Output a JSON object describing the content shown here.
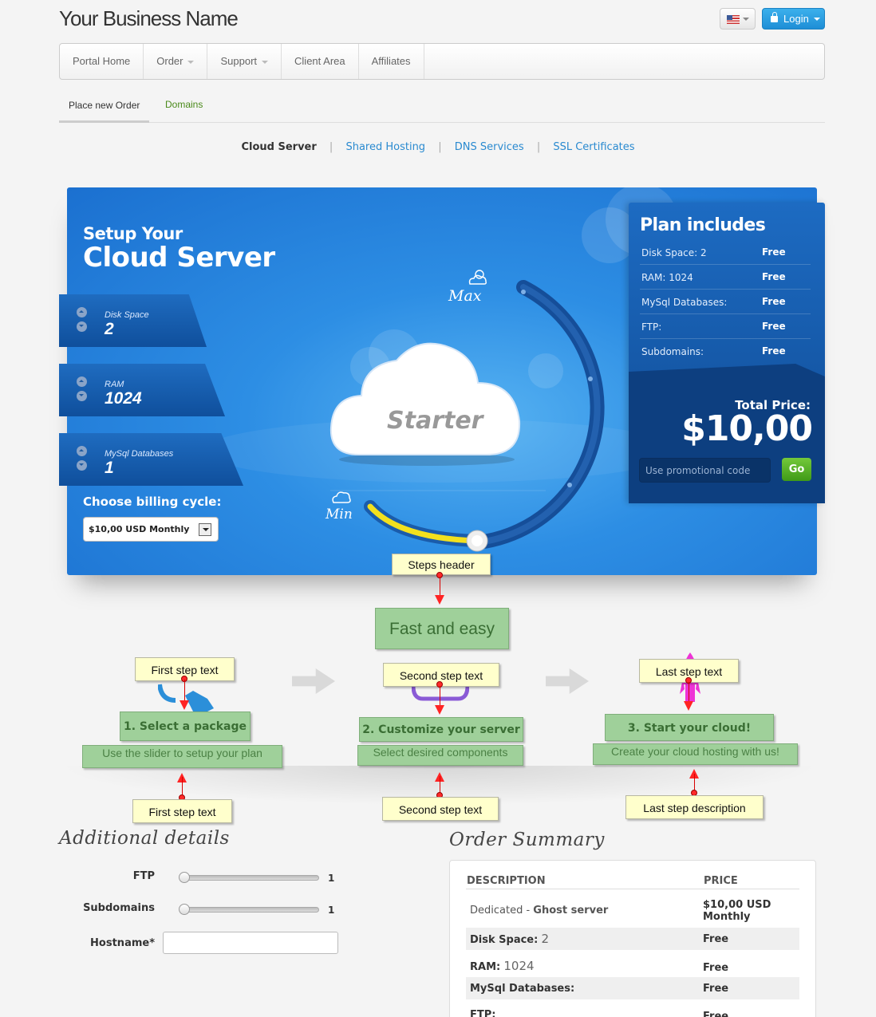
{
  "header": {
    "brand": "Your Business Name",
    "login_label": "Login",
    "flag_icon": "us-flag-icon"
  },
  "nav": [
    {
      "label": "Portal Home",
      "dropdown": false
    },
    {
      "label": "Order",
      "dropdown": true
    },
    {
      "label": "Support",
      "dropdown": true
    },
    {
      "label": "Client Area",
      "dropdown": false
    },
    {
      "label": "Affiliates",
      "dropdown": false
    }
  ],
  "subtabs": {
    "active": "Place new Order",
    "other": "Domains"
  },
  "categories": {
    "active": "Cloud Server",
    "links": [
      "Shared Hosting",
      "DNS Services",
      "SSL Certificates"
    ],
    "separator": "|"
  },
  "hero": {
    "title_line1": "Setup Your",
    "title_line2": "Cloud Server",
    "options": [
      {
        "label": "Disk Space",
        "value": "2"
      },
      {
        "label": "RAM",
        "value": "1024"
      },
      {
        "label": "MySql Databases",
        "value": "1"
      }
    ],
    "billing_label": "Choose billing cycle:",
    "billing_value": "$10,00 USD Monthly",
    "plan_name": "Starter",
    "max_label": "Max",
    "min_label": "Min",
    "slider_level": 0.08
  },
  "plan": {
    "title": "Plan includes",
    "rows": [
      {
        "k": "Disk Space: 2",
        "v": "Free"
      },
      {
        "k": "RAM: 1024",
        "v": "Free"
      },
      {
        "k": "MySql Databases:",
        "v": "Free"
      },
      {
        "k": "FTP:",
        "v": "Free"
      },
      {
        "k": "Subdomains:",
        "v": "Free"
      }
    ],
    "total_label": "Total Price:",
    "total_value": "$10,00",
    "promo_placeholder": "Use promotional code",
    "go_label": "Go"
  },
  "annotations": {
    "steps_header_note": "Steps header",
    "steps_header": "Fast and easy",
    "notes_top": [
      "First step text",
      "Second step text",
      "Last step text"
    ],
    "steps": [
      "1. Select a package",
      "2. Customize your server",
      "3. Start your cloud!"
    ],
    "descs": [
      "Use the slider to setup your plan",
      "Select desired components",
      "Create your cloud hosting with us!"
    ],
    "notes_bottom": [
      "First step text",
      "Second step text",
      "Last step description"
    ]
  },
  "details": {
    "title": "Additional details",
    "ftp_label": "FTP",
    "ftp_value": "1",
    "sub_label": "Subdomains",
    "sub_value": "1",
    "host_label": "Hostname*"
  },
  "summary": {
    "title": "Order Summary",
    "col_desc": "DESCRIPTION",
    "col_price": "PRICE",
    "row1_prefix": "Dedicated - ",
    "row1_name": "Ghost server",
    "row1_price_a": "$10,00 USD",
    "row1_price_b": "Monthly",
    "row2_label": "Disk Space:",
    "row2_val": "2",
    "row2_price": "Free",
    "row3_label": "RAM:",
    "row3_val": "1024",
    "row3_price": "Free",
    "row4_label": "MySql Databases:",
    "row4_price": "Free",
    "row5_label": "FTP:",
    "row5_price": "Free"
  }
}
